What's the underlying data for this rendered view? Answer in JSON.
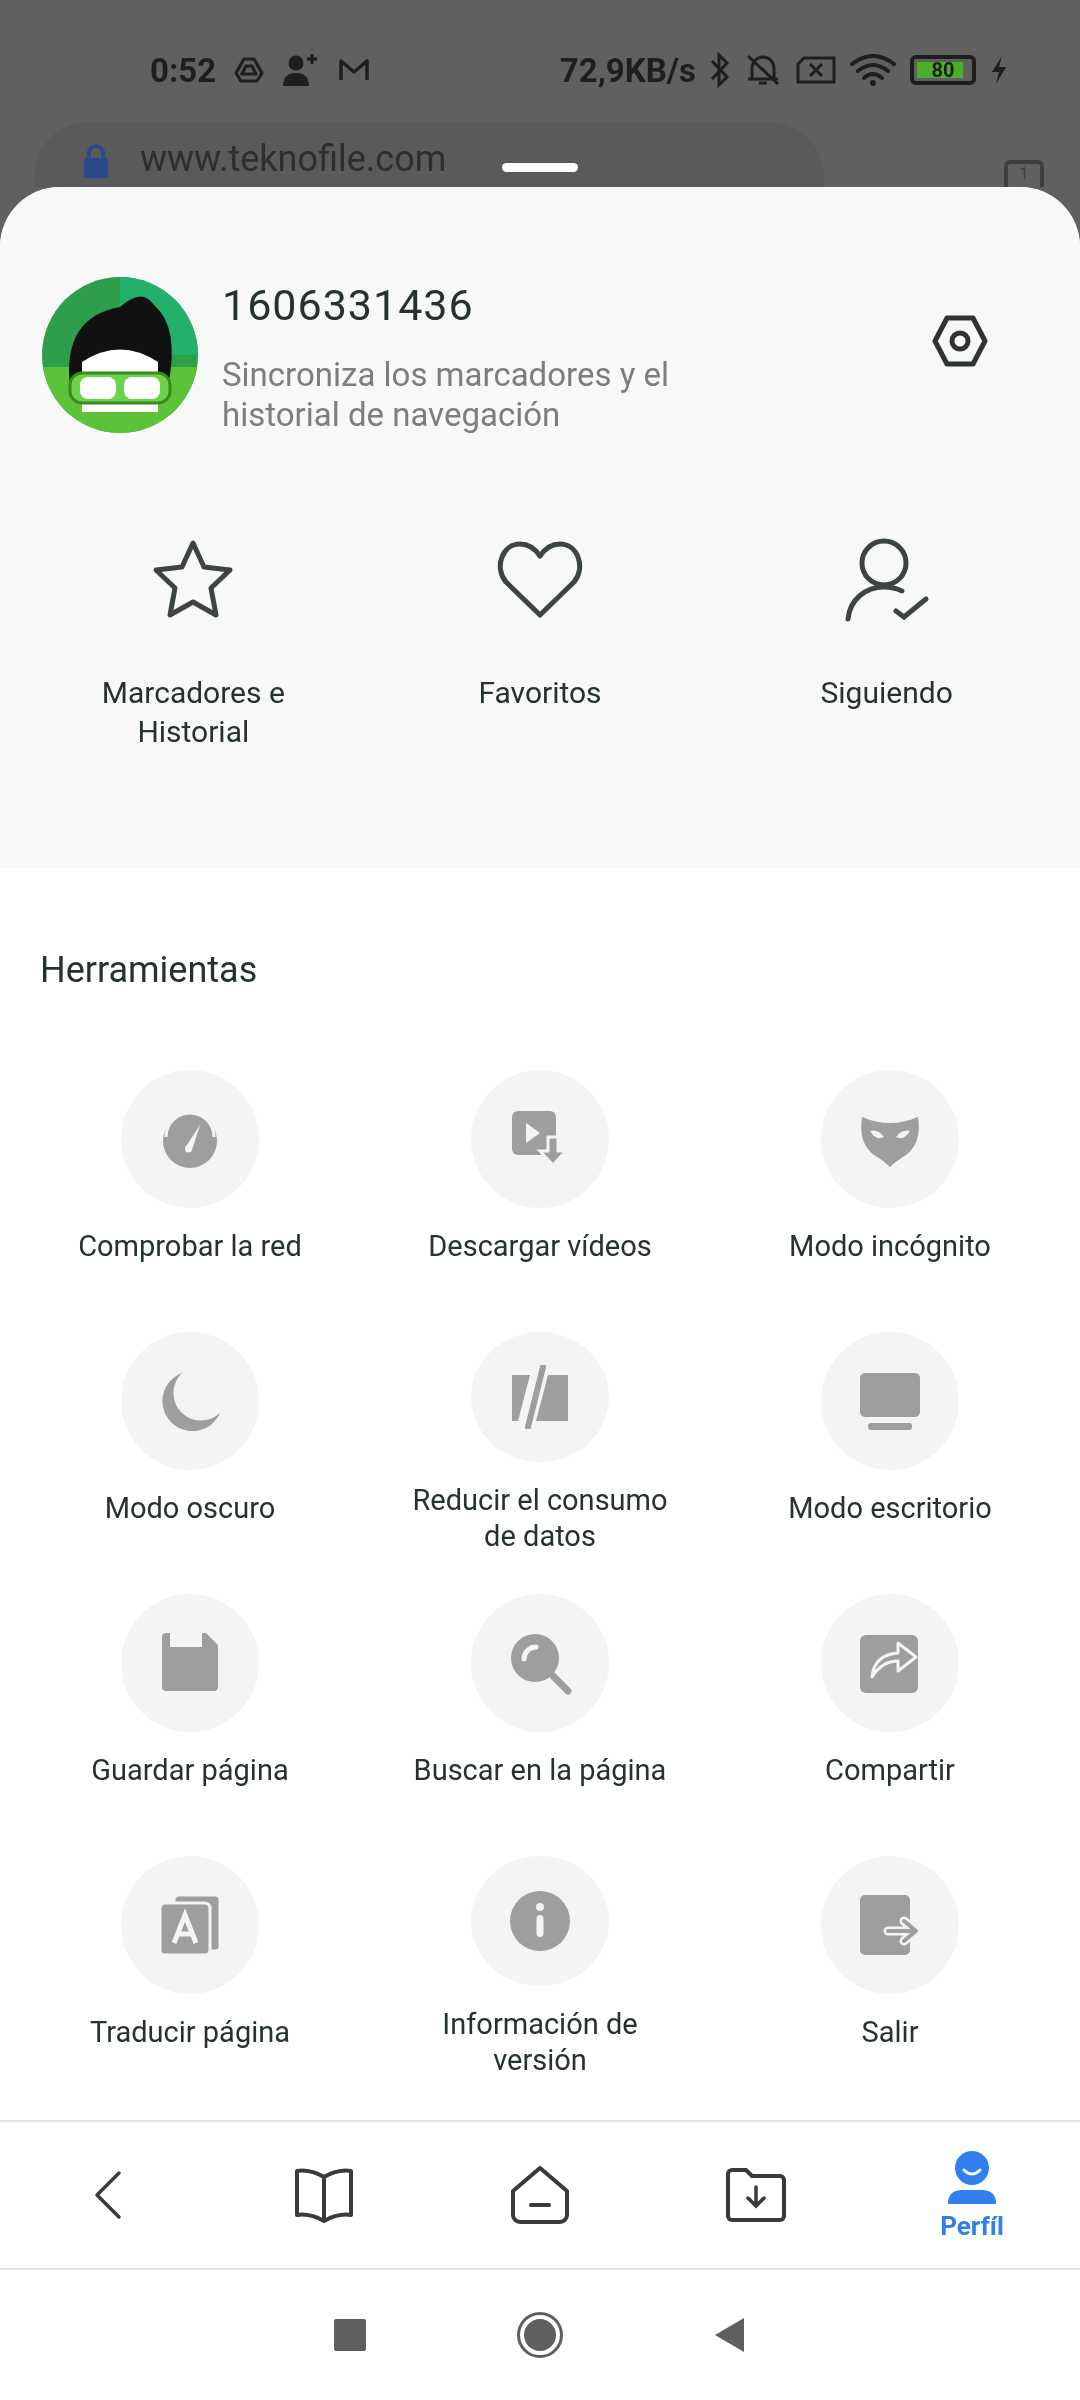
{
  "status_bar": {
    "time": "0:52",
    "speed": "72,9KB/s",
    "battery": "80"
  },
  "browser": {
    "url": "www.teknofile.com",
    "tab_count": "1"
  },
  "profile": {
    "name": "1606331436",
    "subtitle": "Sincroniza los marcadores y el historial de navegación"
  },
  "shortcuts": [
    {
      "kind": "star",
      "label": "Marcadores e Historial"
    },
    {
      "kind": "heart",
      "label": "Favoritos"
    },
    {
      "kind": "following",
      "label": "Siguiendo"
    }
  ],
  "tools": {
    "title": "Herramientas",
    "items": [
      {
        "kind": "speed",
        "label": "Comprobar la red"
      },
      {
        "kind": "video",
        "label": "Descargar vídeos"
      },
      {
        "kind": "mask",
        "label": "Modo incógnito"
      },
      {
        "kind": "moon",
        "label": "Modo oscuro"
      },
      {
        "kind": "data",
        "label": "Reducir el consumo de datos"
      },
      {
        "kind": "desktop",
        "label": "Modo escritorio"
      },
      {
        "kind": "save",
        "label": "Guardar página"
      },
      {
        "kind": "search",
        "label": "Buscar en la página"
      },
      {
        "kind": "share",
        "label": "Compartir"
      },
      {
        "kind": "translate",
        "label": "Traducir página"
      },
      {
        "kind": "info",
        "label": "Información de versión"
      },
      {
        "kind": "exit",
        "label": "Salir"
      }
    ]
  },
  "bottom_nav": [
    {
      "kind": "back",
      "selected": false
    },
    {
      "kind": "book",
      "selected": false
    },
    {
      "kind": "home",
      "selected": false
    },
    {
      "kind": "downloads",
      "selected": false
    },
    {
      "kind": "profile",
      "label": "Perfíl",
      "selected": true
    }
  ]
}
